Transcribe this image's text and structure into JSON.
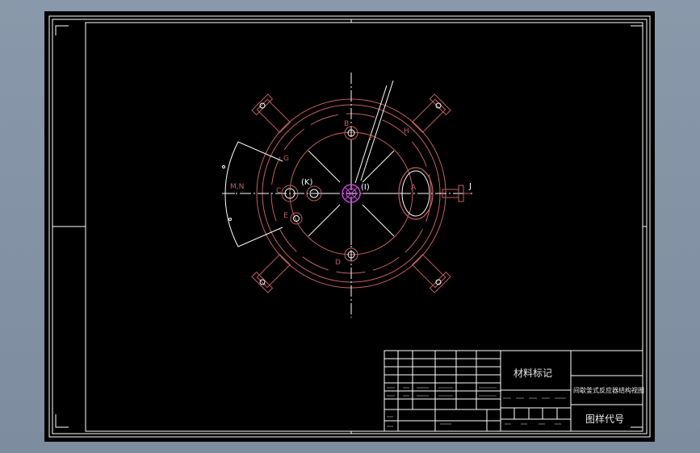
{
  "labels": {
    "B": "B",
    "H": "H",
    "F": "F",
    "G": "G",
    "C": "C",
    "K": "(K)",
    "I": "(I)",
    "A": "A",
    "J": "J",
    "E": "E",
    "D": "D",
    "MN": "M,N"
  },
  "title_block": {
    "material_mark": "材料标记",
    "drawing_title": "间歇釜式反应器结构视图",
    "drawing_code": "图样代号"
  },
  "colors": {
    "background": "#8a98ab",
    "sheet": "#000000",
    "frame": "#ffffff",
    "outline": "#c26060",
    "dim_line": "#ffffff",
    "highlight": "#d040e0"
  }
}
